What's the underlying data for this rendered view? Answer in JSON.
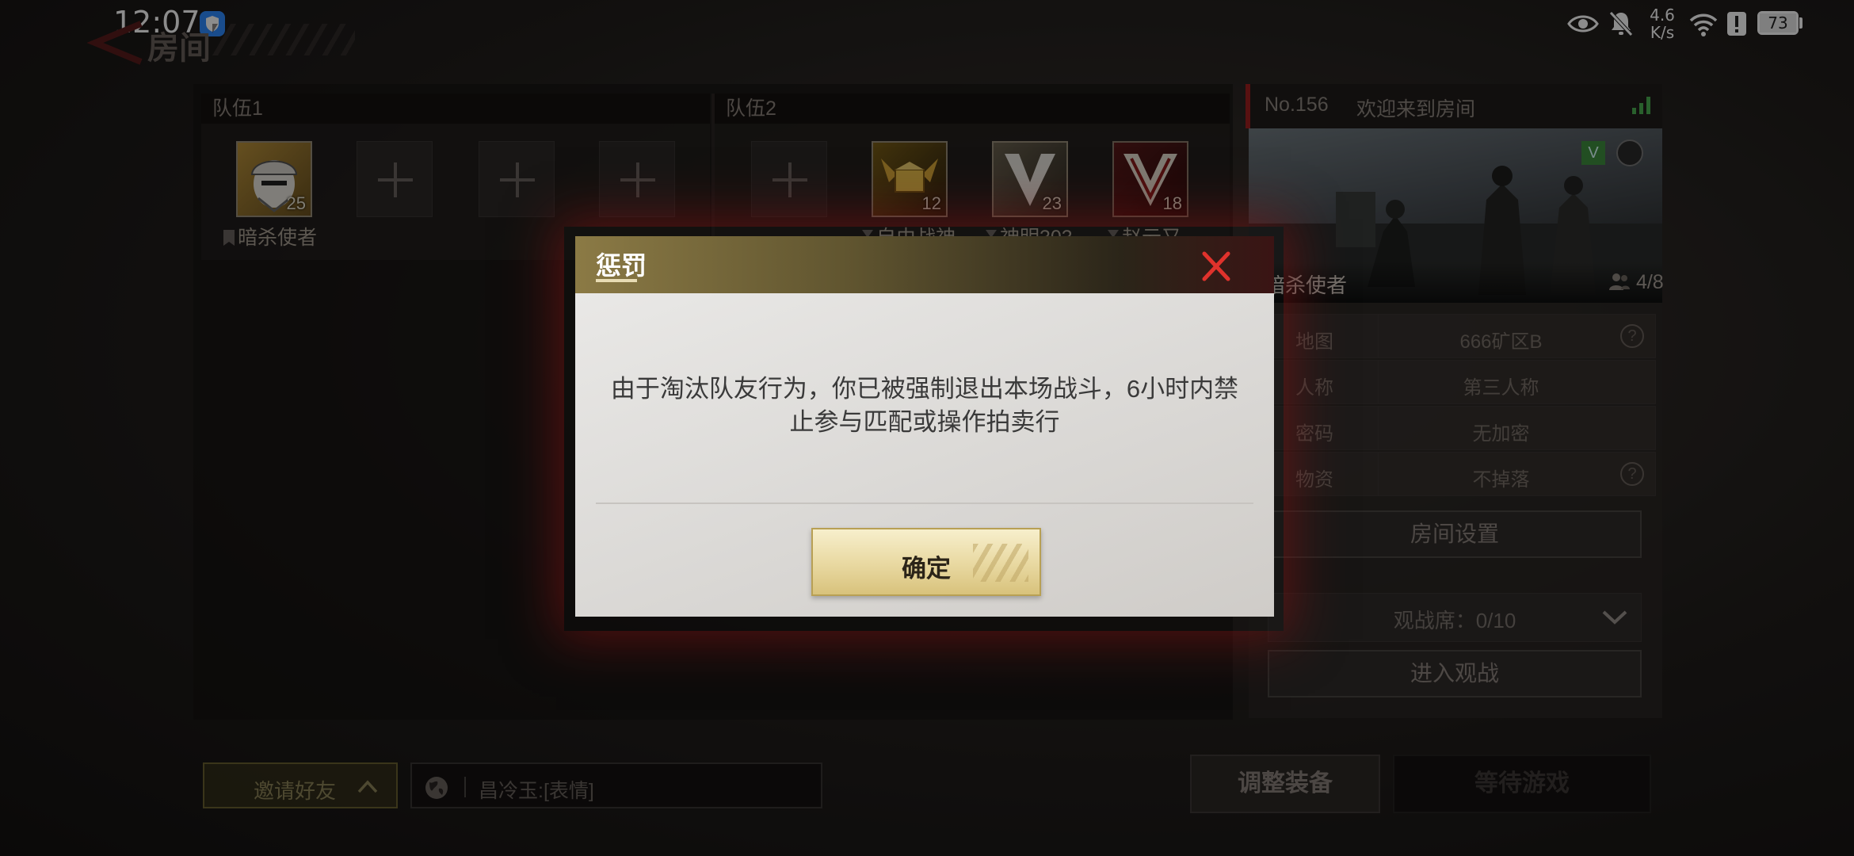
{
  "status_bar": {
    "time": "12:07",
    "net_speed_value": "4.6",
    "net_speed_unit": "K/s",
    "battery": "73"
  },
  "page": {
    "title": "房间"
  },
  "teams": [
    {
      "header": "队伍1",
      "players": [
        {
          "name": "暗杀使者",
          "level": "25"
        }
      ]
    },
    {
      "header": "队伍2",
      "players": [
        {
          "name": "自由战神",
          "level": "12"
        },
        {
          "name": "神明303",
          "level": "23"
        },
        {
          "name": "赵云又",
          "level": "18"
        }
      ]
    }
  ],
  "room": {
    "number": "No.156",
    "welcome": "欢迎来到房间",
    "host": "暗杀使者",
    "player_count": "4/8",
    "settings": [
      {
        "key": "地图",
        "value": "666矿区B",
        "help": true
      },
      {
        "key": "人称",
        "value": "第三人称",
        "help": false
      },
      {
        "key": "密码",
        "value": "无加密",
        "help": false
      },
      {
        "key": "物资",
        "value": "不掉落",
        "help": true
      }
    ],
    "settings_button": "房间设置",
    "spectator_label": "观战席：0/10",
    "spectate_button": "进入观战"
  },
  "bottom_bar": {
    "invite_label": "邀请好友",
    "chat_text": "昌冷玉:[表情]",
    "adjust_button": "调整装备",
    "wait_button": "等待游戏"
  },
  "dialog": {
    "title": "惩罚",
    "message": "由于淘汰队友行为，你已被强制退出本场战斗，6小时内禁止参与匹配或操作拍卖行",
    "confirm": "确定"
  },
  "colors": {
    "accent_gold": "#d8c27c",
    "close_red": "#e0322c",
    "signal_green": "#4caf50"
  }
}
